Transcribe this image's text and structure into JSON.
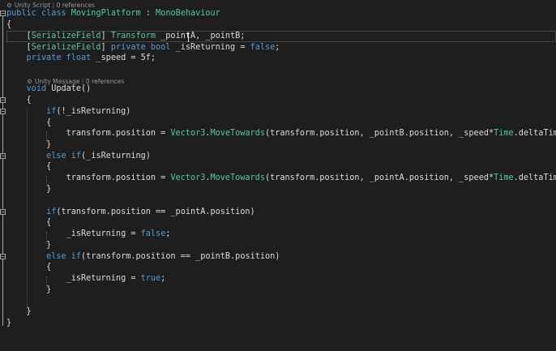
{
  "theme": {
    "background": "#1e1e1e",
    "keyword": "#569cd6",
    "type": "#4ec9b0",
    "text": "#dcdcdc",
    "codelens": "#999999"
  },
  "codelens": [
    {
      "kind": "Unity Script",
      "refs": "0 references"
    },
    {
      "kind": "Unity Message",
      "refs": "0 references"
    }
  ],
  "code": {
    "l1": [
      {
        "t": "public",
        "c": "kw"
      },
      {
        "t": " "
      },
      {
        "t": "class",
        "c": "kw"
      },
      {
        "t": " "
      },
      {
        "t": "MovingPlatform",
        "c": "ty"
      },
      {
        "t": " : "
      },
      {
        "t": "MonoBehaviour",
        "c": "ty"
      }
    ],
    "l2": [
      {
        "t": "{"
      }
    ],
    "l3": [
      {
        "t": "    ["
      },
      {
        "t": "SerializeField",
        "c": "ty"
      },
      {
        "t": "] "
      },
      {
        "t": "Transform",
        "c": "ty"
      },
      {
        "t": " _pointA, _pointB;"
      }
    ],
    "l4": [
      {
        "t": "    ["
      },
      {
        "t": "SerializeField",
        "c": "ty"
      },
      {
        "t": "] "
      },
      {
        "t": "private",
        "c": "kw"
      },
      {
        "t": " "
      },
      {
        "t": "bool",
        "c": "kw"
      },
      {
        "t": " _isReturning = "
      },
      {
        "t": "false",
        "c": "kw"
      },
      {
        "t": ";"
      }
    ],
    "l5": [
      {
        "t": "    "
      },
      {
        "t": "private",
        "c": "kw"
      },
      {
        "t": " "
      },
      {
        "t": "float",
        "c": "kw"
      },
      {
        "t": " _speed = 5f;"
      }
    ],
    "l6": [
      {
        "t": ""
      }
    ],
    "l7": [
      {
        "t": "    "
      },
      {
        "t": "void",
        "c": "kw"
      },
      {
        "t": " Update()"
      }
    ],
    "l8": [
      {
        "t": "    {"
      }
    ],
    "l9": [
      {
        "t": "        "
      },
      {
        "t": "if",
        "c": "kw"
      },
      {
        "t": "(!_isReturning)"
      }
    ],
    "l10": [
      {
        "t": "        {"
      }
    ],
    "l11": [
      {
        "t": "            transform.position = "
      },
      {
        "t": "Vector3",
        "c": "ty"
      },
      {
        "t": "."
      },
      {
        "t": "MoveTowards",
        "c": "ty"
      },
      {
        "t": "(transform.position, _pointB.position, _speed*"
      },
      {
        "t": "Time",
        "c": "ty"
      },
      {
        "t": ".deltaTime);"
      }
    ],
    "l12": [
      {
        "t": "        }"
      }
    ],
    "l13": [
      {
        "t": "        "
      },
      {
        "t": "else",
        "c": "kw"
      },
      {
        "t": " "
      },
      {
        "t": "if",
        "c": "kw"
      },
      {
        "t": "(_isReturning)"
      }
    ],
    "l14": [
      {
        "t": "        {"
      }
    ],
    "l15": [
      {
        "t": "            transform.position = "
      },
      {
        "t": "Vector3",
        "c": "ty"
      },
      {
        "t": "."
      },
      {
        "t": "MoveTowards",
        "c": "ty"
      },
      {
        "t": "(transform.position, _pointA.position, _speed*"
      },
      {
        "t": "Time",
        "c": "ty"
      },
      {
        "t": ".deltaTime);"
      }
    ],
    "l16": [
      {
        "t": "        }"
      }
    ],
    "l17": [
      {
        "t": ""
      }
    ],
    "l18": [
      {
        "t": "        "
      },
      {
        "t": "if",
        "c": "kw"
      },
      {
        "t": "(transform.position == _pointA.position)"
      }
    ],
    "l19": [
      {
        "t": "        {"
      }
    ],
    "l20": [
      {
        "t": "            _isReturning = "
      },
      {
        "t": "false",
        "c": "kw"
      },
      {
        "t": ";"
      }
    ],
    "l21": [
      {
        "t": "        }"
      }
    ],
    "l22": [
      {
        "t": "        "
      },
      {
        "t": "else",
        "c": "kw"
      },
      {
        "t": " "
      },
      {
        "t": "if",
        "c": "kw"
      },
      {
        "t": "(transform.position == _pointB.position)"
      }
    ],
    "l23": [
      {
        "t": "        {"
      }
    ],
    "l24": [
      {
        "t": "            _isReturning = "
      },
      {
        "t": "true",
        "c": "kw"
      },
      {
        "t": ";"
      }
    ],
    "l25": [
      {
        "t": "        }"
      }
    ],
    "l26": [
      {
        "t": ""
      }
    ],
    "l27": [
      {
        "t": "    }"
      }
    ],
    "l28": [
      {
        "t": "}"
      }
    ]
  }
}
